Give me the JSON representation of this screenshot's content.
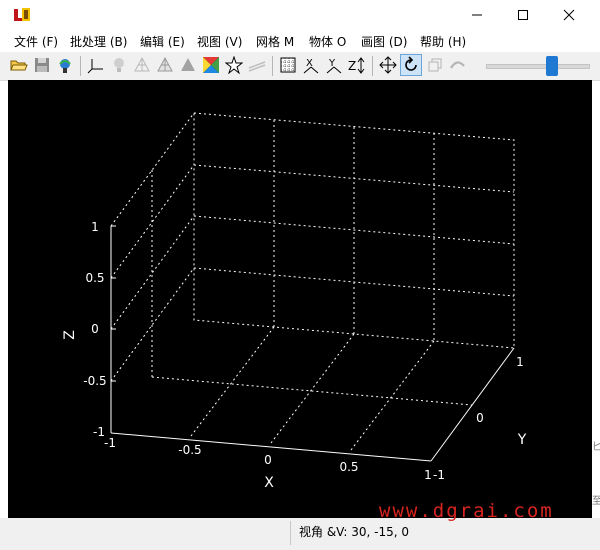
{
  "menu": {
    "items": [
      {
        "label": "文件 (F)",
        "name": "menu-file"
      },
      {
        "label": "批处理 (B)",
        "name": "menu-batch"
      },
      {
        "label": "编辑 (E)",
        "name": "menu-edit"
      },
      {
        "label": "视图 (V)",
        "name": "menu-view"
      },
      {
        "label": "网格 M",
        "name": "menu-mesh"
      },
      {
        "label": "物体 O",
        "name": "menu-object"
      },
      {
        "label": "画图 (D)",
        "name": "menu-draw"
      },
      {
        "label": "帮助 (H)",
        "name": "menu-help"
      }
    ]
  },
  "toolbar": {
    "icons": [
      "open-folder-icon",
      "save-icon",
      "network-icon",
      "axes-icon",
      "light-bulb-icon",
      "wireframe-icon",
      "mesh-icon",
      "solid-blob-icon",
      "color-spectrum-icon",
      "star-icon",
      "lines-icon",
      "grid-box-icon",
      "x-axis-icon",
      "y-axis-icon",
      "z-axis-icon",
      "move-icon",
      "rotate-icon",
      "zoom-icon",
      "undo-icon"
    ],
    "active": "rotate-icon"
  },
  "plot": {
    "z_label": "Z",
    "x_label": "X",
    "y_label": "Y",
    "z_ticks": [
      "1",
      "0.5",
      "0",
      "-0.5",
      "-1"
    ],
    "x_ticks": [
      "-1",
      "-0.5",
      "0",
      "0.5",
      "1"
    ],
    "y_ticks": [
      "-1",
      "0",
      "1"
    ],
    "grid": "dotted",
    "background": "#000000",
    "axis_color": "#ffffff"
  },
  "status": {
    "text": "视角 &V: 30, -15, 0"
  },
  "watermark": "www.dgrai.com",
  "right_fragments": [
    "匕",
    "至"
  ]
}
